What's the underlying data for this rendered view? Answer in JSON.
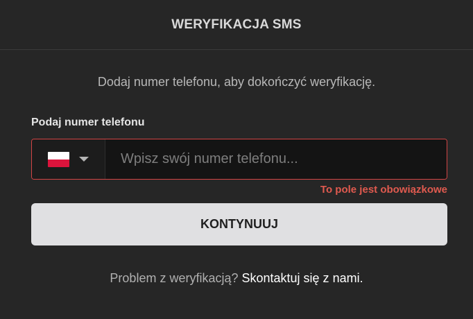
{
  "header": {
    "title": "WERYFIKACJA SMS"
  },
  "form": {
    "subtitle": "Dodaj numer telefonu, aby dokończyć weryfikację.",
    "phone_label": "Podaj numer telefonu",
    "country_flag_icon": "poland-flag-icon",
    "phone_placeholder": "Wpisz swój numer telefonu...",
    "phone_value": "",
    "error": "To pole jest obowiązkowe",
    "submit_label": "KONTYNUUJ"
  },
  "footer": {
    "question": "Problem z weryfikacją?",
    "link_label": "Skontaktuj się z nami."
  },
  "colors": {
    "background": "#262626",
    "error": "#e05a4f",
    "button_bg": "#e0e0e2"
  }
}
